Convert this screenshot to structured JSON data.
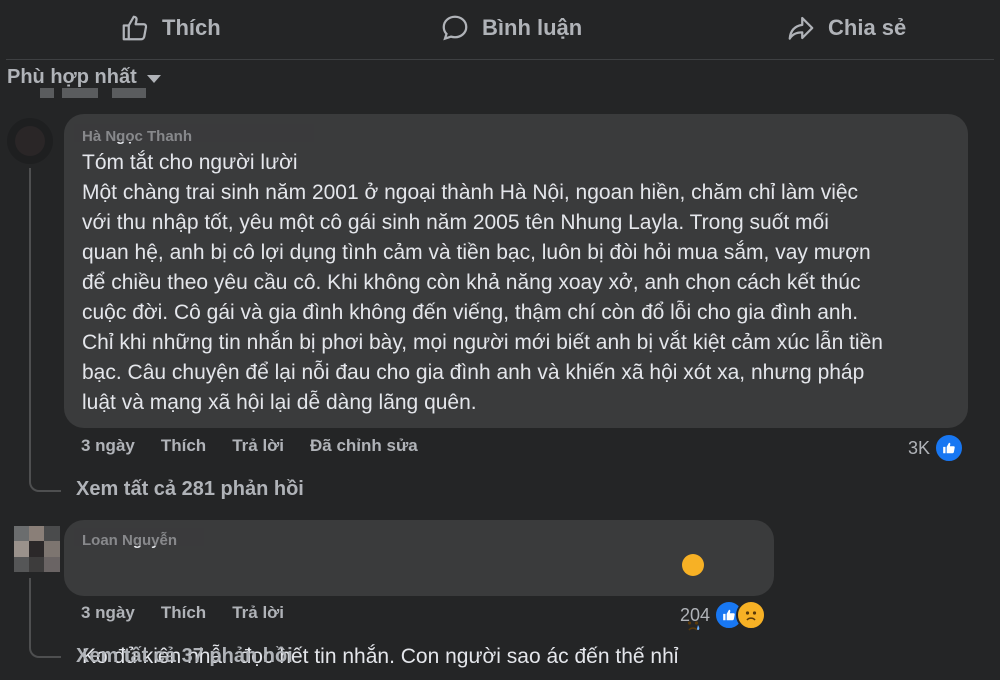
{
  "actions": {
    "like_label": "Thích",
    "comment_label": "Bình luận",
    "share_label": "Chia sẻ"
  },
  "sort": {
    "label": "Phù hợp nhất"
  },
  "comments": [
    {
      "author": "Hà Ngọc Thanh",
      "text": "Tóm tắt cho người lười\nMột chàng trai sinh năm 2001 ở ngoại thành Hà Nội, ngoan hiền, chăm chỉ làm việc\nvới thu nhập tốt, yêu một cô gái sinh năm 2005 tên Nhung Layla. Trong suốt mối\nquan hệ, anh bị cô lợi dụng tình cảm và tiền bạc, luôn bị đòi hỏi mua sắm, vay mượn\nđể chiều theo yêu cầu cô. Khi không còn khả năng xoay xở, anh chọn cách kết thúc\ncuộc đời. Cô gái và gia đình không đến viếng, thậm chí còn đổ lỗi cho gia đình anh.\nChỉ khi những tin nhắn bị phơi bày, mọi người mới biết anh bị vắt kiệt cảm xúc lẫn tiền\nbạc. Câu chuyện để lại nỗi đau cho gia đình anh và khiến xã hội xót xa, nhưng pháp\nluật và mạng xã hội lại dễ dàng lãng quên.",
      "time": "3 ngày",
      "like": "Thích",
      "reply": "Trả lời",
      "edited": "Đã chỉnh sửa",
      "reaction_count": "3K",
      "view_replies": "Xem tất cả 281 phản hồi"
    },
    {
      "author": "Loan Nguyễn",
      "text": "Ko đủ kiên nhẫn đọc hết tin nhắn. Con người sao ác đến thế nhỉ",
      "time": "3 ngày",
      "like": "Thích",
      "reply": "Trả lời",
      "reaction_count": "204",
      "view_replies": "Xem tất cả 37 phản hồi"
    }
  ],
  "icons": {
    "like": "thumbs-up-icon",
    "comment": "speech-bubble-icon",
    "share": "share-arrow-icon",
    "sad": "sad-face-icon"
  },
  "colors": {
    "background": "#242526",
    "bubble": "#3a3b3c",
    "text": "#e4e6eb",
    "muted": "#b0b3b8",
    "like_blue": "#1877f2",
    "emoji_yellow": "#f7b125"
  }
}
